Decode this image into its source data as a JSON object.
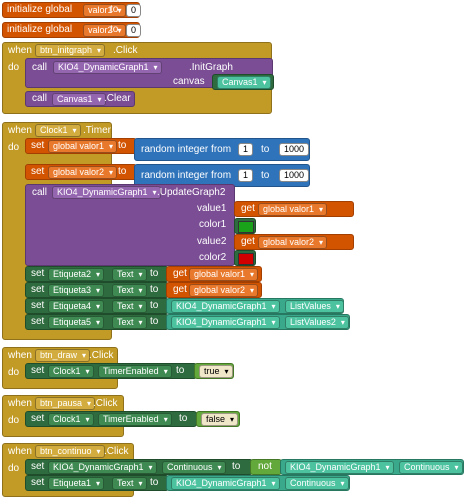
{
  "init1": {
    "label": "initialize global",
    "var": "valor1",
    "to": "to",
    "value": "0"
  },
  "init2": {
    "label": "initialize global",
    "var": "valor2",
    "to": "to",
    "value": "0"
  },
  "ev1": {
    "when": "when",
    "component": "btn_initgraph",
    "event": ".Click",
    "do": "do",
    "call1": {
      "call": "call",
      "component": "KIO4_DynamicGraph1",
      "method": ".InitGraph",
      "param": "canvas",
      "arg": "Canvas1"
    },
    "call2": {
      "call": "call",
      "component": "Canvas1",
      "method": ".Clear"
    }
  },
  "ev2": {
    "when": "when",
    "component": "Clock1",
    "event": ".Timer",
    "do": "do",
    "set1": {
      "set": "set",
      "var": "global valor1",
      "to": "to",
      "rand": "random integer from",
      "from": "1",
      "to2": "to",
      "max": "1000"
    },
    "set2": {
      "set": "set",
      "var": "global valor2",
      "to": "to",
      "rand": "random integer from",
      "from": "1",
      "to2": "to",
      "max": "1000"
    },
    "call": {
      "call": "call",
      "component": "KIO4_DynamicGraph1",
      "method": ".UpdateGraph2",
      "p1": "value1",
      "p2": "color1",
      "p3": "value2",
      "p4": "color2",
      "get1": "get",
      "getv1": "global valor1",
      "get2": "get",
      "getv2": "global valor2",
      "color1": "#1aa31a",
      "color2": "#d30000"
    },
    "s3": {
      "set": "set",
      "comp": "Etiqueta2",
      "prop": "Text",
      "to": "to",
      "get": "get",
      "val": "global valor1"
    },
    "s4": {
      "set": "set",
      "comp": "Etiqueta3",
      "prop": "Text",
      "to": "to",
      "get": "get",
      "val": "global valor2"
    },
    "s5": {
      "set": "set",
      "comp": "Etiqueta4",
      "prop": "Text",
      "to": "to",
      "comp2": "KIO4_DynamicGraph1",
      "prop2": "ListValues"
    },
    "s6": {
      "set": "set",
      "comp": "Etiqueta5",
      "prop": "Text",
      "to": "to",
      "comp2": "KIO4_DynamicGraph1",
      "prop2": "ListValues2"
    }
  },
  "ev3": {
    "when": "when",
    "component": "btn_draw",
    "event": ".Click",
    "do": "do",
    "set": "set",
    "comp": "Clock1",
    "prop": "TimerEnabled",
    "to": "to",
    "val": "true"
  },
  "ev4": {
    "when": "when",
    "component": "btn_pausa",
    "event": ".Click",
    "do": "do",
    "set": "set",
    "comp": "Clock1",
    "prop": "TimerEnabled",
    "to": "to",
    "val": "false"
  },
  "ev5": {
    "when": "when",
    "component": "btn_continuo",
    "event": ".Click",
    "do": "do",
    "s1": {
      "set": "set",
      "comp": "KIO4_DynamicGraph1",
      "prop": "Continuous",
      "to": "to",
      "not": "not",
      "comp2": "KIO4_DynamicGraph1",
      "prop2": "Continuous"
    },
    "s2": {
      "set": "set",
      "comp": "Etiqueta1",
      "prop": "Text",
      "to": "to",
      "comp2": "KIO4_DynamicGraph1",
      "prop2": "Continuous"
    }
  }
}
